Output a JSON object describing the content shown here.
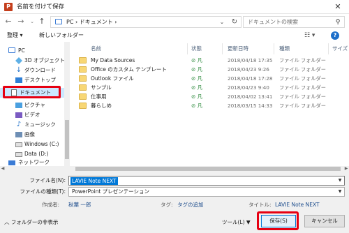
{
  "window": {
    "title": "名前を付けて保存",
    "app_icon": "P"
  },
  "address": {
    "path": "PC  ›  ドキュメント  ›"
  },
  "search": {
    "placeholder": "ドキュメントの検索"
  },
  "toolbar": {
    "organize": "整理 ▾",
    "new_folder": "新しいフォルダー"
  },
  "nav": {
    "items": [
      {
        "label": "PC"
      },
      {
        "label": "3D オブジェクト"
      },
      {
        "label": "ダウンロード"
      },
      {
        "label": "デスクトップ"
      },
      {
        "label": "ドキュメント"
      },
      {
        "label": "ピクチャ"
      },
      {
        "label": "ビデオ"
      },
      {
        "label": "ミュージック"
      },
      {
        "label": "画像"
      },
      {
        "label": "Windows (C:)"
      },
      {
        "label": "Data (D:)"
      },
      {
        "label": "ネットワーク"
      }
    ],
    "selected": "ドキュメント"
  },
  "columns": {
    "name": "名前",
    "status": "状態",
    "date": "更新日時",
    "type": "種類",
    "size": "サイズ"
  },
  "files": [
    {
      "name": "My Data Sources",
      "status": "⊘ 凡",
      "date": "2018/04/18 17:35",
      "type": "ファイル フォルダー"
    },
    {
      "name": "Office のカスタム テンプレート",
      "status": "⊘ 凡",
      "date": "2018/04/23 9:26",
      "type": "ファイル フォルダー"
    },
    {
      "name": "Outlook ファイル",
      "status": "⊘ 凡",
      "date": "2018/04/18 17:28",
      "type": "ファイル フォルダー"
    },
    {
      "name": "サンプル",
      "status": "⊘ 凡",
      "date": "2018/04/23 9:40",
      "type": "ファイル フォルダー"
    },
    {
      "name": "仕事用",
      "status": "⊘ 凡",
      "date": "2018/04/02 13:41",
      "type": "ファイル フォルダー"
    },
    {
      "name": "暮らしめ",
      "status": "⊘ 凡",
      "date": "2018/03/15 14:33",
      "type": "ファイル フォルダー"
    }
  ],
  "form": {
    "filename_label": "ファイル名(N):",
    "filename_value": "LAVIE Note NEXT",
    "filetype_label": "ファイルの種類(T):",
    "filetype_value": "PowerPoint プレゼンテーション",
    "author_label": "作成者:",
    "author_value": "秋葉 一郎",
    "tags_label": "タグ:",
    "tags_value": "タグの追加",
    "title_label": "タイトル:",
    "title_value": "LAVIE Note NEXT"
  },
  "footer": {
    "hide_folders": "フォルダーの非表示",
    "tools": "ツール(L)",
    "save": "保存(S)",
    "cancel": "キャンセル"
  },
  "colors": {
    "highlight": "#e60012",
    "accent": "#0078d7",
    "folder": "#f8d775"
  }
}
